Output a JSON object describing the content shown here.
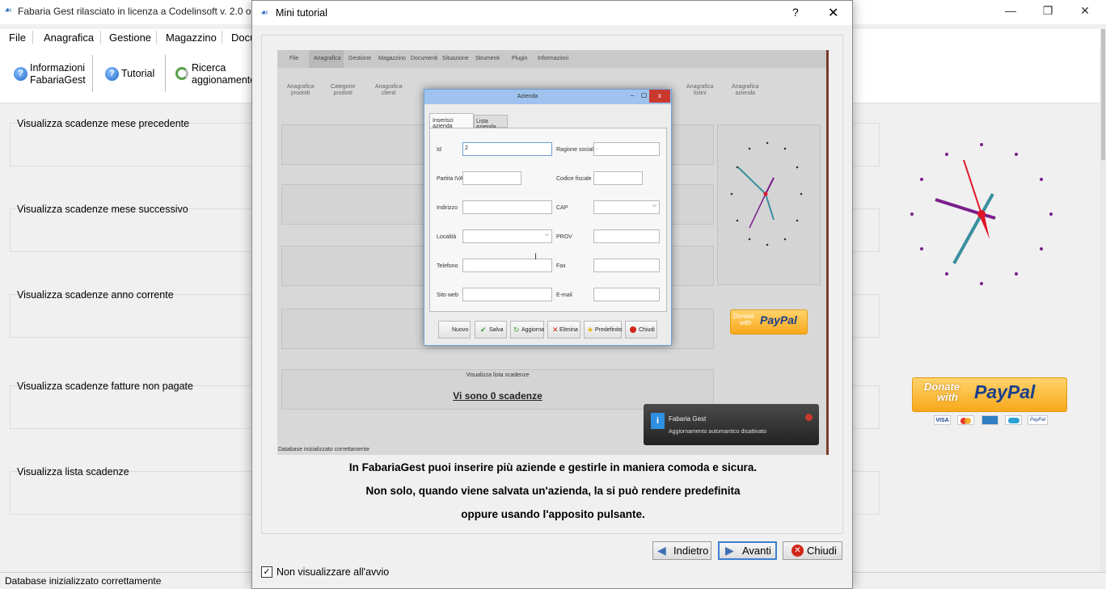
{
  "app": {
    "title": "Fabaria Gest rilasciato in licenza a Codelinsoft  v. 2.0  op",
    "window_controls": {
      "minimize": "—",
      "restore": "❐",
      "close": "✕"
    }
  },
  "menu": [
    "File",
    "Anagrafica",
    "Gestione",
    "Magazzino",
    "Docu"
  ],
  "ribbon": {
    "info": {
      "line1": "Informazioni",
      "line2": "FabariaGest"
    },
    "tutorial": "Tutorial",
    "update": {
      "line1": "Ricerca",
      "line2": "aggionamento"
    }
  },
  "panels": [
    "Visualizza scadenze mese precedente",
    "Visualizza scadenze mese successivo",
    "Visualizza scadenze anno corrente",
    "Visualizza scadenze fatture non pagate",
    "Visualizza lista scadenze"
  ],
  "status": "Database inizializzato correttamente",
  "paypal": {
    "donate": "Donate",
    "with": "with",
    "brand": "PayPal",
    "cards": [
      "VISA",
      "MC",
      "AMEX",
      "CARD",
      "PayPal"
    ]
  },
  "dialog": {
    "title": "Mini tutorial",
    "help": "?",
    "close": "✕",
    "caption": [
      "In FabariaGest puoi inserire più aziende e gestirle in maniera comoda e sicura.",
      "Non solo, quando viene salvata un'azienda, la si può rendere predefinita",
      "oppure usando l'apposito pulsante."
    ],
    "buttons": {
      "back": "Indietro",
      "next": "Avanti",
      "close": "Chiudi"
    },
    "checkbox": {
      "label": "Non visualizzare all'avvio",
      "checked": true
    }
  },
  "screenshot": {
    "menu": [
      "File",
      "Anagrafica",
      "Gestione",
      "Magazzino",
      "Documenti",
      "Situazione",
      "Strumenti",
      "Plugin",
      "Informazioni"
    ],
    "ribbon": [
      {
        "l1": "Anagrafica",
        "l2": "prodotti"
      },
      {
        "l1": "Categorie",
        "l2": "prodotti"
      },
      {
        "l1": "Anagrafica",
        "l2": "clienti"
      },
      {
        "l1": "Anagrafica",
        "l2": "listini"
      },
      {
        "l1": "Anagrafica",
        "l2": "azienda"
      }
    ],
    "scadenze_title": "Visualizza lista scadenze",
    "scadenze_value": "Vi sono 0 scadenze",
    "status": "Database inizializzato correttamente",
    "notification": {
      "title": "Fabaria Gest",
      "text": "Aggiornamento automantico disattivato"
    },
    "azienda": {
      "title": "Azienda",
      "tabs": [
        "Inserisci azienda",
        "Lista azienda"
      ],
      "fields": {
        "id": {
          "label": "Id",
          "value": "2"
        },
        "ragione": {
          "label": "Ragione sociale",
          "value": "."
        },
        "piva": {
          "label": "Partita IVA",
          "value": ""
        },
        "cf": {
          "label": "Codice fiscale",
          "value": ""
        },
        "indirizzo": {
          "label": "Indirizzo",
          "value": ""
        },
        "cap": {
          "label": "CAP",
          "value": ""
        },
        "localita": {
          "label": "Località",
          "value": ""
        },
        "prov": {
          "label": "PROV",
          "value": ""
        },
        "telefono": {
          "label": "Telefono",
          "value": ""
        },
        "fax": {
          "label": "Fax",
          "value": ""
        },
        "sito": {
          "label": "Sito web",
          "value": ""
        },
        "email": {
          "label": "E-mail",
          "value": ""
        }
      },
      "buttons": [
        "Nuovo",
        "Salva",
        "Aggiorna",
        "Elimina",
        "Predefinito",
        "Chiudi"
      ]
    }
  },
  "colors": {
    "accent": "#3c7fd1",
    "clock_hour": "#7a1e8a",
    "clock_minute": "#3a8ea0",
    "clock_second": "#e0162b",
    "paypal": "#f7a81b"
  }
}
